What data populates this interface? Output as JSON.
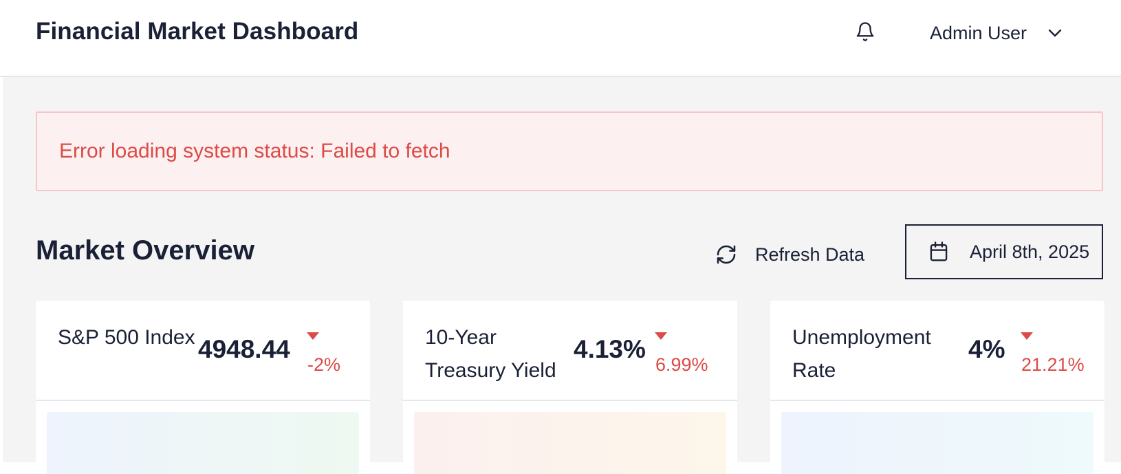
{
  "header": {
    "title": "Financial Market Dashboard",
    "notifications_icon": "bell-icon",
    "user_name": "Admin User",
    "user_menu_icon": "chevron-down-icon"
  },
  "alert": {
    "message": "Error loading system status: Failed to fetch",
    "color": "#dc4b47"
  },
  "overview": {
    "title": "Market Overview",
    "refresh_label": "Refresh Data",
    "refresh_icon": "refresh-icon",
    "date_label": "April 8th, 2025",
    "date_icon": "calendar-icon"
  },
  "cards": [
    {
      "label": "S&P 500 Index",
      "value": "4948.44",
      "change": "-2%",
      "trend": "down"
    },
    {
      "label": "10-Year Treasury Yield",
      "value": "4.13%",
      "change": "6.99%",
      "trend": "down"
    },
    {
      "label": "Unemployment Rate",
      "value": "4%",
      "change": "21.21%",
      "trend": "down"
    }
  ],
  "colors": {
    "text": "#1a2035",
    "negative": "#dc4b47",
    "background": "#f4f4f5"
  }
}
